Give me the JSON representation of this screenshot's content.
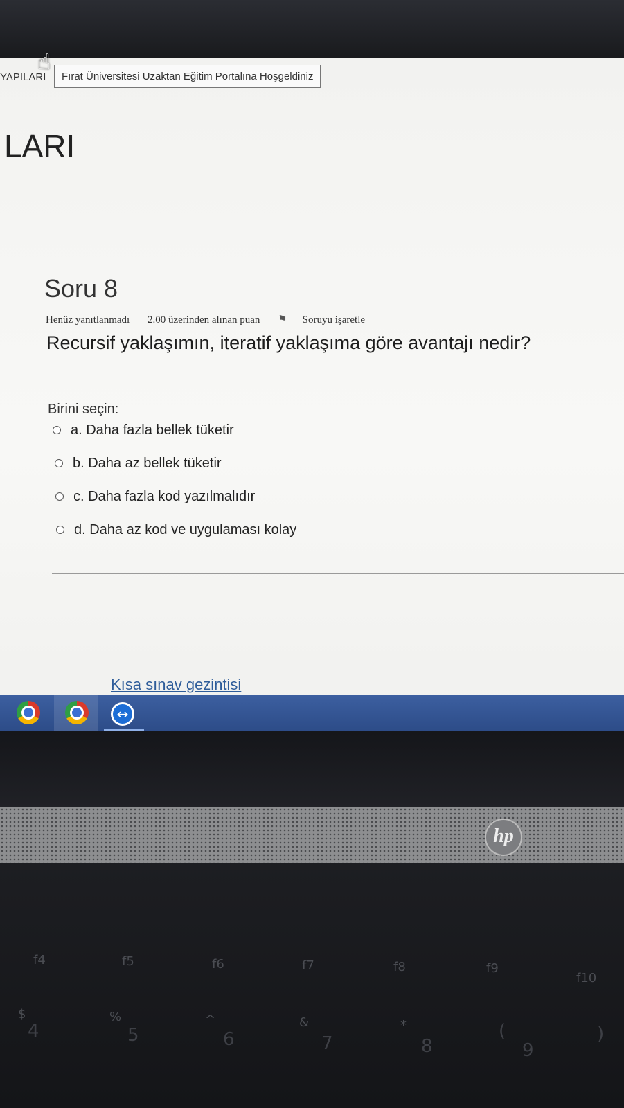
{
  "browser": {
    "tab_left": "YAPILARI",
    "tab_right": "Fırat Üniversitesi Uzaktan Eğitim Portalına Hoşgeldiniz"
  },
  "page": {
    "heading": "LARI"
  },
  "question": {
    "title": "Soru 8",
    "status": "Henüz yanıtlanmadı",
    "points": "2.00 üzerinden alınan puan",
    "flag_label": "Soruyu işaretle",
    "text": "Recursif yaklaşımın, iteratif yaklaşıma göre avantajı nedir?",
    "choose_label": "Birini seçin:",
    "options": [
      {
        "label": "a. Daha fazla bellek tüketir"
      },
      {
        "label": "b. Daha az bellek tüketir"
      },
      {
        "label": "c. Daha fazla kod yazılmalıdır"
      },
      {
        "label": "d. Daha az kod ve uygulaması kolay"
      }
    ]
  },
  "navigation": {
    "link": "Kısa sınav gezintisi"
  },
  "taskbar": {
    "icons": [
      "chrome-icon",
      "chrome-icon",
      "teamviewer-icon"
    ]
  },
  "laptop": {
    "brand": "hp",
    "fn_keys": [
      "f4",
      "f5",
      "f6",
      "f7",
      "f8",
      "f9",
      "f10"
    ],
    "number_keys": [
      "4",
      "5",
      "6",
      "7",
      "8",
      "9"
    ],
    "symbol_keys": [
      "$",
      "%",
      "^",
      "&",
      "*",
      "(",
      ")"
    ]
  },
  "colors": {
    "link": "#2f5d9a",
    "taskbar": "#3c5fa0",
    "page_bg": "#f4f4f2"
  }
}
